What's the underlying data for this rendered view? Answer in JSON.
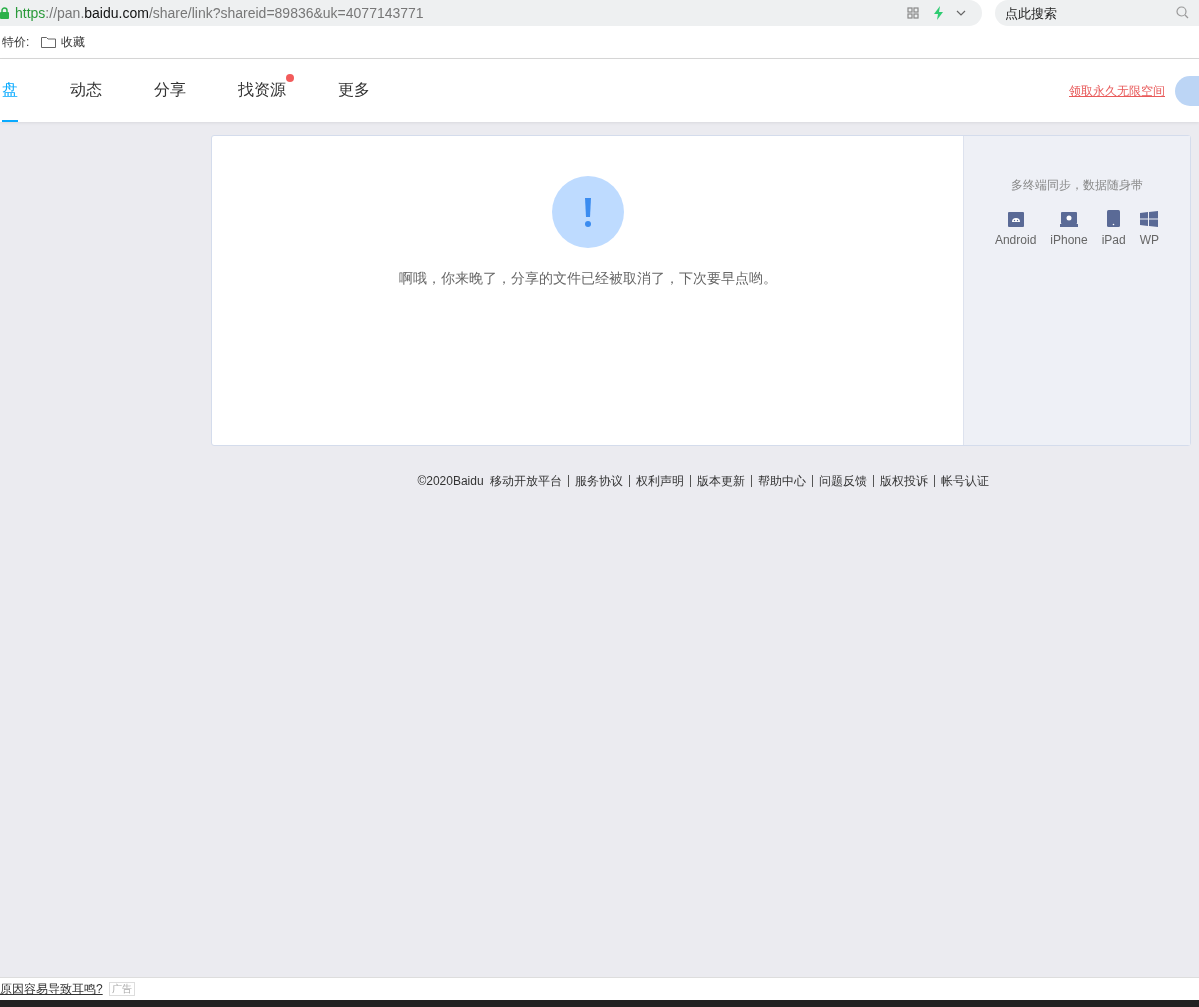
{
  "address_bar": {
    "scheme": "https",
    "host_prefix": "://pan.",
    "domain": "baidu.com",
    "path": "/share/link?shareid=89836&uk=4077143771"
  },
  "search": {
    "placeholder": "点此搜索"
  },
  "bookmarks": [
    {
      "label": "特价:",
      "kind": "text"
    },
    {
      "label": "收藏",
      "kind": "folder"
    }
  ],
  "nav": {
    "tabs": [
      {
        "label": "盘",
        "selected": true,
        "badge": false
      },
      {
        "label": "动态",
        "selected": false,
        "badge": false
      },
      {
        "label": "分享",
        "selected": false,
        "badge": false
      },
      {
        "label": "找资源",
        "selected": false,
        "badge": true
      },
      {
        "label": "更多",
        "selected": false,
        "badge": false
      }
    ],
    "promo_link": "领取永久无限空间"
  },
  "message": "啊哦，你来晚了，分享的文件已经被取消了，下次要早点哟。",
  "side_panel": {
    "title": "多终端同步，数据随身带",
    "platforms": [
      {
        "label": "Android",
        "kind": "android"
      },
      {
        "label": "iPhone",
        "kind": "iphone"
      },
      {
        "label": "iPad",
        "kind": "ipad"
      },
      {
        "label": "WP",
        "kind": "windows"
      }
    ]
  },
  "footer": {
    "copyright": "©2020Baidu",
    "links": [
      "移动开放平台",
      "服务协议",
      "权利声明",
      "版本更新",
      "帮助中心",
      "问题反馈",
      "版权投诉",
      "帐号认证"
    ]
  },
  "status_bar": {
    "ad_link": "原因容易导致耳鸣?",
    "ad_tag": "广告"
  }
}
